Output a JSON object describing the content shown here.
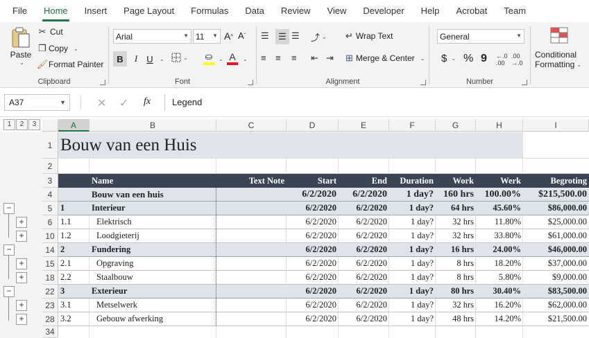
{
  "menu": [
    "File",
    "Home",
    "Insert",
    "Page Layout",
    "Formulas",
    "Data",
    "Review",
    "View",
    "Developer",
    "Help",
    "Acrobat",
    "Team"
  ],
  "menu_active": "Home",
  "ribbon": {
    "clipboard": {
      "paste": "Paste",
      "cut": "Cut",
      "copy": "Copy",
      "format_painter": "Format Painter",
      "label": "Clipboard"
    },
    "font": {
      "name": "Arial",
      "size": "11",
      "bold": "B",
      "italic": "I",
      "underline": "U",
      "label": "Font"
    },
    "alignment": {
      "wrap_text": "Wrap Text",
      "merge_center": "Merge & Center",
      "label": "Alignment"
    },
    "number": {
      "format": "General",
      "currency": "$",
      "percent": "%",
      "comma": "9",
      "label": "Number"
    },
    "styles": {
      "conditional_line1": "Conditional",
      "conditional_line2": "Formatting"
    }
  },
  "formula_bar": {
    "name_box": "A37",
    "fx": "fx",
    "value": "Legend"
  },
  "outline_levels": [
    "1",
    "2",
    "3"
  ],
  "columns": [
    "A",
    "B",
    "C",
    "D",
    "E",
    "F",
    "G",
    "H",
    "I"
  ],
  "selected_column": "A",
  "rows": {
    "r1": {
      "num": "1",
      "title": "Bouw van een Huis"
    },
    "r2": {
      "num": "2"
    },
    "r3": {
      "num": "3",
      "name": "Name",
      "text_note": "Text Note",
      "start": "Start",
      "end": "End",
      "duration": "Duration",
      "work": "Work",
      "werk": "Werk",
      "begroting": "Begroting"
    },
    "r4": {
      "num": "4",
      "name": "Bouw van een huis",
      "start": "6/2/2020",
      "end": "6/2/2020",
      "duration": "1 day?",
      "work": "160 hrs",
      "werk": "100.00%",
      "begroting": "$215,500.00"
    },
    "r5": {
      "num": "5",
      "id": "1",
      "name": "Interieur",
      "start": "6/2/2020",
      "end": "6/2/2020",
      "duration": "1 day?",
      "work": "64 hrs",
      "werk": "45.60%",
      "begroting": "$86,000.00"
    },
    "r6": {
      "num": "6",
      "id": "1.1",
      "name": "Elektrisch",
      "start": "6/2/2020",
      "end": "6/2/2020",
      "duration": "1 day?",
      "work": "32 hrs",
      "werk": "11.80%",
      "begroting": "$25,000.00"
    },
    "r10": {
      "num": "10",
      "id": "1.2",
      "name": "Loodgieterij",
      "start": "6/2/2020",
      "end": "6/2/2020",
      "duration": "1 day?",
      "work": "32 hrs",
      "werk": "33.80%",
      "begroting": "$61,000.00"
    },
    "r14": {
      "num": "14",
      "id": "2",
      "name": "Fundering",
      "start": "6/2/2020",
      "end": "6/2/2020",
      "duration": "1 day?",
      "work": "16 hrs",
      "werk": "24.00%",
      "begroting": "$46,000.00"
    },
    "r15": {
      "num": "15",
      "id": "2.1",
      "name": "Opgraving",
      "start": "6/2/2020",
      "end": "6/2/2020",
      "duration": "1 day?",
      "work": "8 hrs",
      "werk": "18.20%",
      "begroting": "$37,000.00"
    },
    "r18": {
      "num": "18",
      "id": "2.2",
      "name": "Staalbouw",
      "start": "6/2/2020",
      "end": "6/2/2020",
      "duration": "1 day?",
      "work": "8 hrs",
      "werk": "5.80%",
      "begroting": "$9,000.00"
    },
    "r22": {
      "num": "22",
      "id": "3",
      "name": "Exterieur",
      "start": "6/2/2020",
      "end": "6/2/2020",
      "duration": "1 day?",
      "work": "80 hrs",
      "werk": "30.40%",
      "begroting": "$83,500.00"
    },
    "r23": {
      "num": "23",
      "id": "3.1",
      "name": "Metselwerk",
      "start": "6/2/2020",
      "end": "6/2/2020",
      "duration": "1 day?",
      "work": "32 hrs",
      "werk": "16.20%",
      "begroting": "$62,000.00"
    },
    "r28": {
      "num": "28",
      "id": "3.2",
      "name": "Gebouw afwerking",
      "start": "6/2/2020",
      "end": "6/2/2020",
      "duration": "1 day?",
      "work": "48 hrs",
      "werk": "14.20%",
      "begroting": "$21,500.00"
    },
    "r34": {
      "num": "34"
    }
  },
  "outline_buttons": {
    "minus": "−",
    "plus": "+"
  },
  "colors": {
    "accent": "#217346",
    "header_dark": "#3b4452",
    "summary_fill": "#dfe3ea",
    "title_fill": "#dfe3ea"
  }
}
